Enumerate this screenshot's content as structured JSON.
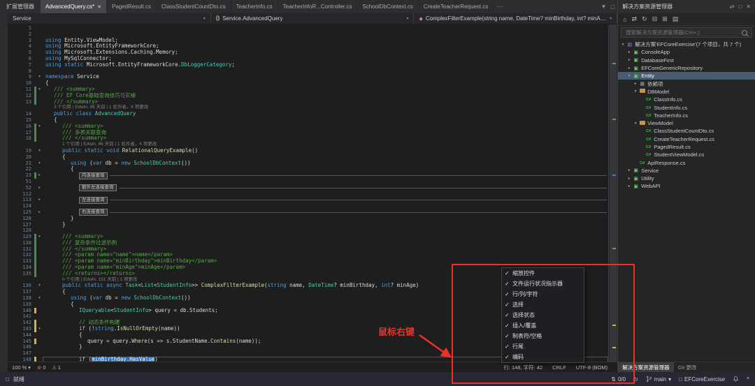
{
  "left_rail": {
    "collapsed_tab_label": "扩展管理器"
  },
  "tabs": {
    "items": [
      {
        "label": "AdvancedQuery.cs*",
        "active": true
      },
      {
        "label": "PagedResult.cs"
      },
      {
        "label": "ClassStudentCountDto.cs"
      },
      {
        "label": "TeacherInfo.cs"
      },
      {
        "label": "TeacherInfoR...Controller.cs"
      },
      {
        "label": "SchoolDbContext.cs"
      },
      {
        "label": "CreateTeacherRequest.cs"
      }
    ]
  },
  "breadcrumbs": [
    {
      "label": "Service",
      "icon": ""
    },
    {
      "label": "Service.AdvancedQuery",
      "icon": "class"
    },
    {
      "label": "ComplexFilterExample(string name, DateTime? minBirthday, int? minAge)",
      "icon": "method"
    }
  ],
  "editor": {
    "lines": [
      {
        "n": "1",
        "t": "b"
      },
      {
        "n": "2",
        "t": "b"
      },
      {
        "n": "3",
        "i": 0,
        "s": [
          [
            "k",
            "using "
          ],
          [
            "p",
            "Entity.ViewModel;"
          ]
        ]
      },
      {
        "n": "4",
        "i": 0,
        "s": [
          [
            "k",
            "using "
          ],
          [
            "p",
            "Microsoft.EntityFrameworkCore;"
          ]
        ]
      },
      {
        "n": "5",
        "i": 0,
        "s": [
          [
            "k",
            "using "
          ],
          [
            "p",
            "Microsoft.Extensions.Caching.Memory;"
          ]
        ]
      },
      {
        "n": "6",
        "i": 0,
        "s": [
          [
            "k",
            "using "
          ],
          [
            "p",
            "MySqlConnector;"
          ]
        ]
      },
      {
        "n": "7",
        "i": 0,
        "s": [
          [
            "k",
            "using static "
          ],
          [
            "p",
            "Microsoft.EntityFrameworkCore."
          ],
          [
            "ty",
            "DbLoggerCategory"
          ],
          [
            "p",
            ";"
          ]
        ]
      },
      {
        "n": "8",
        "t": "b"
      },
      {
        "n": "9",
        "i": 0,
        "ar": true,
        "s": [
          [
            "k",
            "namespace "
          ],
          [
            "p",
            "Service"
          ]
        ]
      },
      {
        "n": "10",
        "i": 0,
        "s": [
          [
            "p",
            "{"
          ]
        ]
      },
      {
        "n": "11",
        "i": 1,
        "ar": true,
        "chg": "g",
        "s": [
          [
            "c",
            "/// <summary>"
          ]
        ]
      },
      {
        "n": "12",
        "i": 1,
        "chg": "g",
        "s": [
          [
            "c",
            "/// EF Core基础查询技巧与实操"
          ]
        ]
      },
      {
        "n": "13",
        "i": 1,
        "chg": "g",
        "s": [
          [
            "c",
            "/// </summary>"
          ]
        ]
      },
      {
        "t": "l",
        "i": 1,
        "txt": "3 个引用 | Edwin, 86 天前 | 1 名作者，4 项更改"
      },
      {
        "n": "14",
        "i": 1,
        "s": [
          [
            "k",
            "public class "
          ],
          [
            "ty",
            "AdvancedQuery"
          ]
        ]
      },
      {
        "n": "15",
        "i": 1,
        "s": [
          [
            "p",
            "{"
          ]
        ]
      },
      {
        "n": "16",
        "i": 2,
        "ar": true,
        "chg": "g",
        "s": [
          [
            "c",
            "/// <summary>"
          ]
        ]
      },
      {
        "n": "17",
        "i": 2,
        "chg": "g",
        "s": [
          [
            "c",
            "/// 多表关联查询"
          ]
        ]
      },
      {
        "n": "18",
        "i": 2,
        "chg": "g",
        "s": [
          [
            "c",
            "/// </summary>"
          ]
        ]
      },
      {
        "t": "l",
        "i": 2,
        "txt": "1 个引用 | Edwin, 86 天前 | 1 名作者，4 项更改"
      },
      {
        "n": "19",
        "i": 2,
        "ar": true,
        "s": [
          [
            "k",
            "public static void "
          ],
          [
            "m",
            "RelationalQueryExample"
          ],
          [
            "p",
            "()"
          ]
        ]
      },
      {
        "n": "20",
        "i": 2,
        "s": [
          [
            "p",
            "{"
          ]
        ]
      },
      {
        "n": "21",
        "i": 3,
        "ar": true,
        "s": [
          [
            "k",
            "using "
          ],
          [
            "p",
            "("
          ],
          [
            "k",
            "var"
          ],
          [
            "p",
            " db = "
          ],
          [
            "k",
            "new "
          ],
          [
            "ty",
            "SchoolDbContext"
          ],
          [
            "p",
            "())"
          ]
        ]
      },
      {
        "n": "22",
        "i": 3,
        "s": [
          [
            "p",
            "{"
          ]
        ]
      },
      {
        "n": "23",
        "i": 4,
        "t": "f",
        "lbl": "内连接查询",
        "chg": "g"
      },
      {
        "n": "51",
        "t": "b"
      },
      {
        "n": "52",
        "i": 4,
        "t": "f",
        "lbl": "额外左连接查询"
      },
      {
        "n": "112",
        "t": "b"
      },
      {
        "n": "113",
        "i": 4,
        "t": "f",
        "lbl": "左连接查询"
      },
      {
        "n": "124",
        "t": "b"
      },
      {
        "n": "125",
        "i": 4,
        "t": "f",
        "lbl": "右连接查询"
      },
      {
        "n": "126",
        "i": 3,
        "s": [
          [
            "p",
            "}"
          ]
        ]
      },
      {
        "n": "127",
        "i": 2,
        "s": [
          [
            "p",
            "}"
          ]
        ]
      },
      {
        "n": "128",
        "t": "b"
      },
      {
        "n": "129",
        "i": 2,
        "ar": true,
        "chg": "g",
        "s": [
          [
            "c",
            "/// <summary>"
          ]
        ]
      },
      {
        "n": "130",
        "i": 2,
        "chg": "g",
        "s": [
          [
            "c",
            "/// 复杂条件过滤示例"
          ]
        ]
      },
      {
        "n": "131",
        "i": 2,
        "chg": "g",
        "s": [
          [
            "c",
            "/// </summary>"
          ]
        ]
      },
      {
        "n": "132",
        "i": 2,
        "chg": "g",
        "s": [
          [
            "c",
            "/// <param name=\"name\">name</param>"
          ]
        ]
      },
      {
        "n": "133",
        "i": 2,
        "chg": "g",
        "s": [
          [
            "c",
            "/// <param name=\"minBirthday\">minBirthday</param>"
          ]
        ]
      },
      {
        "n": "134",
        "i": 2,
        "chg": "g",
        "s": [
          [
            "c",
            "/// <param name=\"minAge\">minAge</param>"
          ]
        ]
      },
      {
        "n": "135",
        "i": 2,
        "chg": "g",
        "s": [
          [
            "c",
            "/// <returns></returns>"
          ]
        ]
      },
      {
        "t": "l",
        "i": 2,
        "txt": "0 个引用 | Edwin, 151 天前 | 1 项更改"
      },
      {
        "n": "136",
        "i": 2,
        "ar": true,
        "s": [
          [
            "k",
            "public static async "
          ],
          [
            "ty",
            "Task"
          ],
          [
            "p",
            "<"
          ],
          [
            "ty",
            "List"
          ],
          [
            "p",
            "<"
          ],
          [
            "ty",
            "StudentInfo"
          ],
          [
            "p",
            ">> "
          ],
          [
            "m",
            "ComplexFilterExample"
          ],
          [
            "p",
            "("
          ],
          [
            "k",
            "string"
          ],
          [
            "p",
            " name, "
          ],
          [
            "ty",
            "DateTime"
          ],
          [
            "p",
            "? minBirthday, "
          ],
          [
            "k",
            "int"
          ],
          [
            "p",
            "? minAge)"
          ]
        ]
      },
      {
        "n": "137",
        "i": 2,
        "s": [
          [
            "p",
            "{"
          ]
        ]
      },
      {
        "n": "138",
        "i": 3,
        "ar": true,
        "s": [
          [
            "k",
            "using "
          ],
          [
            "p",
            "("
          ],
          [
            "k",
            "var"
          ],
          [
            "p",
            " db = "
          ],
          [
            "k",
            "new "
          ],
          [
            "ty",
            "SchoolDbContext"
          ],
          [
            "p",
            "())"
          ]
        ]
      },
      {
        "n": "139",
        "i": 3,
        "s": [
          [
            "p",
            "{"
          ]
        ]
      },
      {
        "n": "140",
        "i": 4,
        "chg": "y",
        "s": [
          [
            "ty",
            "IQueryable"
          ],
          [
            "p",
            "<"
          ],
          [
            "ty",
            "StudentInfo"
          ],
          [
            "p",
            "> query = db.Students;"
          ]
        ]
      },
      {
        "n": "141",
        "t": "b"
      },
      {
        "n": "142",
        "i": 4,
        "chg": "y",
        "s": [
          [
            "c",
            "// 动态条件构建"
          ]
        ]
      },
      {
        "n": "143",
        "i": 4,
        "ar": true,
        "chg": "y",
        "s": [
          [
            "ctl",
            "if "
          ],
          [
            "p",
            "(!"
          ],
          [
            "k",
            "string"
          ],
          [
            "p",
            "."
          ],
          [
            "m",
            "IsNullOrEmpty"
          ],
          [
            "p",
            "(name))"
          ]
        ]
      },
      {
        "n": "144",
        "i": 4,
        "s": [
          [
            "p",
            "{"
          ]
        ]
      },
      {
        "n": "145",
        "i": 5,
        "chg": "y",
        "s": [
          [
            "p",
            "query = query."
          ],
          [
            "m",
            "Where"
          ],
          [
            "p",
            "(s => s.StudentName."
          ],
          [
            "m",
            "Contains"
          ],
          [
            "p",
            "(name));"
          ]
        ]
      },
      {
        "n": "146",
        "i": 4,
        "s": [
          [
            "p",
            "}"
          ]
        ]
      },
      {
        "n": "147",
        "t": "b"
      },
      {
        "n": "148",
        "i": 4,
        "cur": true,
        "chg": "y",
        "s": [
          [
            "ctl",
            "if "
          ],
          [
            "p",
            "("
          ],
          [
            "sel",
            "minBirthday.HasValue"
          ],
          [
            "p",
            ")"
          ]
        ]
      }
    ]
  },
  "editor_status": {
    "zoom": "100 %",
    "errors": "0",
    "warnings": "1",
    "right_segments": [
      "行: 148, 字符: 42",
      "CRLF",
      "UTF-8 (BOM)"
    ]
  },
  "solution_explorer": {
    "title": "解决方案资源管理器",
    "search_placeholder": "搜索解决方案资源管理器(Ctrl+;)",
    "tree": [
      {
        "d": 0,
        "exp": "e",
        "icon": "sln",
        "label": "解决方案'EFCoreExercise'(7 个项目，共 7 个)"
      },
      {
        "d": 1,
        "exp": "c",
        "icon": "proj",
        "label": "ConsoleApp"
      },
      {
        "d": 1,
        "exp": "c",
        "icon": "proj",
        "label": "DatabaseFirst"
      },
      {
        "d": 1,
        "exp": "c",
        "icon": "proj",
        "label": "EFCoreGenericRepository"
      },
      {
        "d": 1,
        "exp": "e",
        "icon": "proj",
        "label": "Entity",
        "selected": true
      },
      {
        "d": 2,
        "exp": "c",
        "icon": "dep",
        "label": "依赖项"
      },
      {
        "d": 2,
        "exp": "e",
        "icon": "folder",
        "label": "DBModel"
      },
      {
        "d": 3,
        "icon": "cs",
        "label": "ClassInfo.cs"
      },
      {
        "d": 3,
        "icon": "cs",
        "label": "StudentInfo.cs"
      },
      {
        "d": 3,
        "icon": "cs",
        "label": "TeacherInfo.cs"
      },
      {
        "d": 2,
        "exp": "e",
        "icon": "folder",
        "label": "ViewModel"
      },
      {
        "d": 3,
        "icon": "cs",
        "label": "ClassStudentCountDto.cs"
      },
      {
        "d": 3,
        "icon": "cs",
        "label": "CreateTeacherRequest.cs"
      },
      {
        "d": 3,
        "icon": "cs",
        "label": "PagedResult.cs"
      },
      {
        "d": 3,
        "icon": "cs",
        "label": "StudentViewModel.cs"
      },
      {
        "d": 2,
        "icon": "cs",
        "label": "ApiResponse.cs"
      },
      {
        "d": 1,
        "exp": "c",
        "icon": "proj",
        "label": "Service"
      },
      {
        "d": 1,
        "exp": "c",
        "icon": "proj",
        "label": "Utility"
      },
      {
        "d": 1,
        "exp": "c",
        "icon": "proj",
        "label": "WebAPI"
      }
    ],
    "bottom_tabs": [
      {
        "label": "解决方案资源管理器",
        "active": true
      },
      {
        "label": "Git 更改",
        "active": false
      }
    ]
  },
  "context_menu": {
    "items": [
      {
        "label": "缩放控件",
        "checked": true
      },
      {
        "label": "文件运行状况指示器",
        "checked": true
      },
      {
        "label": "行/列/字符",
        "checked": true
      },
      {
        "label": "选择",
        "checked": true
      },
      {
        "label": "选择状态",
        "checked": true
      },
      {
        "label": "插入/覆盖",
        "checked": true
      },
      {
        "label": "制表符/空格",
        "checked": true
      },
      {
        "label": "行尾",
        "checked": true
      },
      {
        "label": "编码",
        "checked": true
      }
    ]
  },
  "annotation": {
    "label": "鼠标右键"
  },
  "status_bar": {
    "ready": "就绪",
    "sync_count": "0/0",
    "branch": "main",
    "solution": "EFCoreExercise"
  }
}
